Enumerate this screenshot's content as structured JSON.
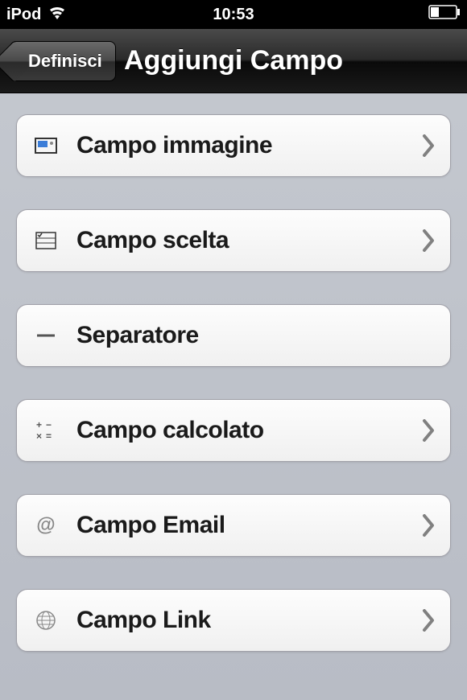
{
  "status": {
    "device": "iPod",
    "time": "10:53"
  },
  "nav": {
    "back": "Definisci",
    "title": "Aggiungi Campo"
  },
  "items": [
    {
      "icon": "image",
      "label": "Campo immagine",
      "chevron": true
    },
    {
      "icon": "choice",
      "label": "Campo scelta",
      "chevron": true
    },
    {
      "icon": "separator",
      "label": "Separatore",
      "chevron": false
    },
    {
      "icon": "calc",
      "label": "Campo calcolato",
      "chevron": true
    },
    {
      "icon": "email",
      "label": "Campo Email",
      "chevron": true
    },
    {
      "icon": "link",
      "label": "Campo Link",
      "chevron": true
    }
  ]
}
